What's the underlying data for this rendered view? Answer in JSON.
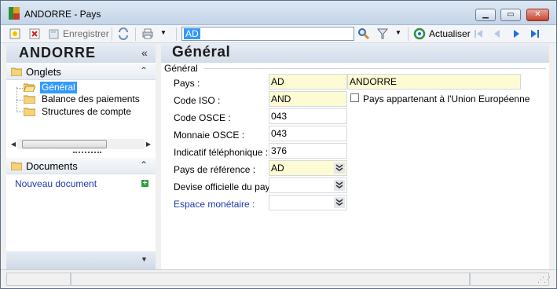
{
  "window": {
    "title": "ANDORRE -  Pays"
  },
  "toolbar": {
    "save_label": "Enregistrer",
    "search_value": "AD",
    "refresh_label": "Actualiser"
  },
  "left": {
    "header": "ANDORRE",
    "collapse": "«",
    "onglets": "Onglets",
    "tree": [
      "Général",
      "Balance des paiements",
      "Structures de compte"
    ],
    "documents": "Documents",
    "new_document": "Nouveau document"
  },
  "right": {
    "title": "Général",
    "group": "Général",
    "labels": {
      "pays": "Pays :",
      "code_iso": "Code ISO :",
      "code_osce": "Code OSCE :",
      "monnaie_osce": "Monnaie OSCE :",
      "indicatif": "Indicatif téléphonique :",
      "pays_ref": "Pays de référence :",
      "devise": "Devise officielle du pays :",
      "espace": "Espace monétaire :"
    },
    "values": {
      "pays_code": "AD",
      "pays_name": "ANDORRE",
      "code_iso": "AND",
      "code_osce": "043",
      "monnaie_osce": "043",
      "indicatif": "376",
      "pays_ref": "AD",
      "devise": "",
      "espace": ""
    },
    "eu_checkbox_label": "Pays appartenant à l'Union Européenne",
    "eu_checked": false
  },
  "colors": {
    "required_field": "#fdfbd3",
    "selection": "#3399ff",
    "link": "#1a3ba8"
  }
}
